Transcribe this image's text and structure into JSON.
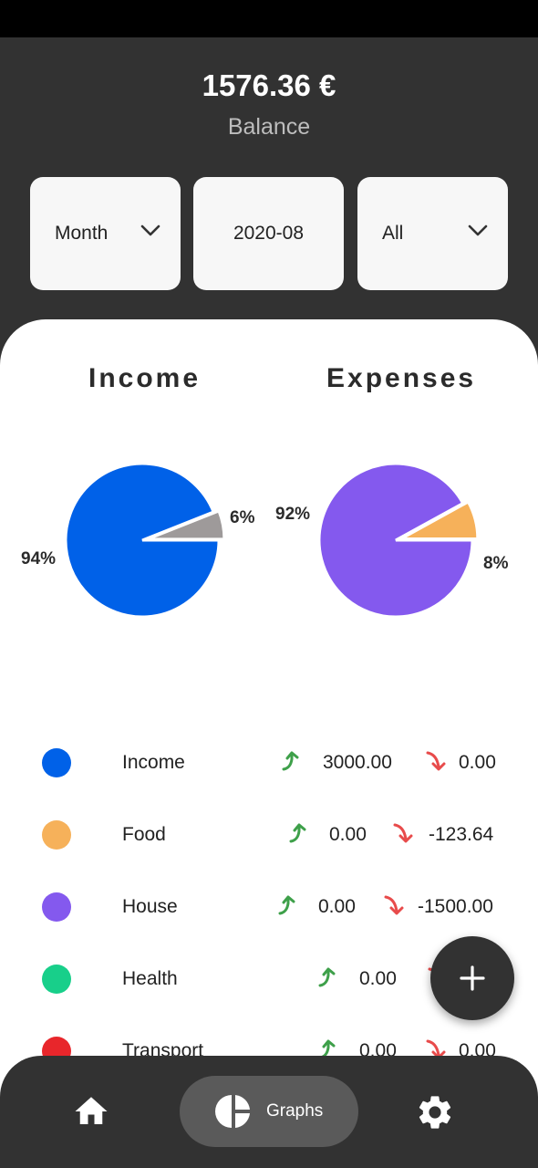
{
  "header": {
    "balance": "1576.36 €",
    "balance_label": "Balance",
    "filters": {
      "period": "Month",
      "date": "2020-08",
      "category": "All"
    }
  },
  "charts": {
    "income_title": "Income",
    "expenses_title": "Expenses",
    "income_pct_major": "94%",
    "income_pct_minor": "6%",
    "expenses_pct_major": "92%",
    "expenses_pct_minor": "8%"
  },
  "chart_data": [
    {
      "type": "pie",
      "title": "Income",
      "labels": [
        "94%",
        "6%"
      ],
      "values": [
        94,
        6
      ],
      "colors": [
        "#0061e8",
        "#9e9a9a"
      ]
    },
    {
      "type": "pie",
      "title": "Expenses",
      "labels": [
        "92%",
        "8%"
      ],
      "values": [
        92,
        8
      ],
      "colors": [
        "#8459ee",
        "#f6b15a"
      ]
    }
  ],
  "legend": [
    {
      "name": "Income",
      "color": "#0061e8",
      "up": "3000.00",
      "down": "0.00"
    },
    {
      "name": "Food",
      "color": "#f6b15a",
      "up": "0.00",
      "down": "-123.64"
    },
    {
      "name": "House",
      "color": "#8459ee",
      "up": "0.00",
      "down": "-1500.00"
    },
    {
      "name": "Health",
      "color": "#18cf8a",
      "up": "0.00",
      "down": ""
    },
    {
      "name": "Transport",
      "color": "#e8262b",
      "up": "0.00",
      "down": "0.00"
    }
  ],
  "icons": {
    "up": "arrow-up-right-icon",
    "down": "arrow-down-right-icon",
    "fab": "plus-icon",
    "home": "home-icon",
    "graphs": "pie-chart-icon",
    "settings": "gear-icon"
  },
  "colors": {
    "dark": "#323232",
    "up_arrow": "#3ea04a",
    "down_arrow": "#e84b4b"
  },
  "nav": {
    "graphs_label": "Graphs"
  }
}
